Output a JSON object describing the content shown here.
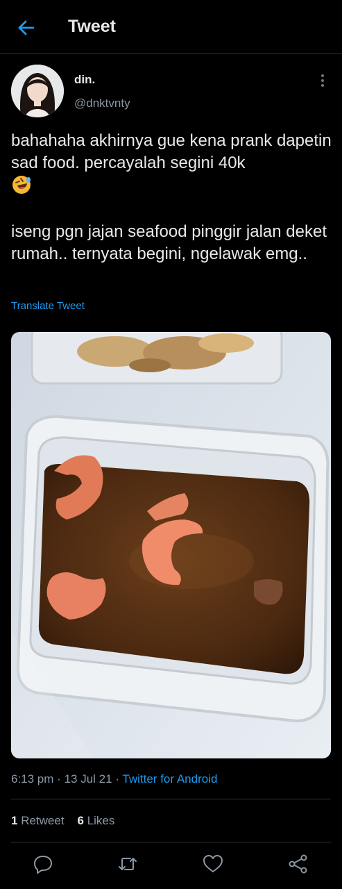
{
  "header": {
    "title": "Tweet",
    "back_icon": "arrow-left-icon",
    "accent": "#1d9bf0"
  },
  "author": {
    "name": "din.",
    "handle": "@dnktvnty",
    "avatar_icon": "profile-photo"
  },
  "tweet": {
    "paragraph1": "bahahaha akhirnya gue kena prank dapetin sad food. percayalah segini 40k",
    "emoji": "rolling-on-floor-laughing-emoji",
    "paragraph2": "iseng pgn jajan seafood pinggir jalan deket rumah.. ternyata begini, ngelawak emg..",
    "translate_label": "Translate Tweet",
    "media": "photo-shrimp-in-sauce-container"
  },
  "meta": {
    "time": "6:13 pm",
    "date": "13 Jul 21",
    "source": "Twitter for Android",
    "separator": "·"
  },
  "stats": {
    "retweets_count": "1",
    "retweets_label": "Retweet",
    "likes_count": "6",
    "likes_label": "Likes"
  },
  "actions": [
    "reply-icon",
    "retweet-icon",
    "like-icon",
    "share-icon"
  ]
}
